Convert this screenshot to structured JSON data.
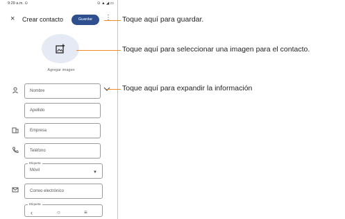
{
  "status_bar": {
    "time": "9:29 a.m. ⊙",
    "icons": "⊙ ▲ ◢ ▭"
  },
  "app_bar": {
    "close_icon": "×",
    "title": "Crear contacto",
    "save_label": "Guardar",
    "more_icon": "⋮"
  },
  "photo": {
    "label": "Agregar imagen"
  },
  "fields": {
    "name": "Nombre",
    "last_name": "Apellido",
    "company": "Empresa",
    "phone": "Teléfono",
    "phone_tag": "Etiqueta",
    "phone_type": "Móvil",
    "email": "Correo electrónico",
    "email_tag": "Etiqueta"
  },
  "nav": {
    "back": "‹",
    "home": "○",
    "recents": "≡"
  },
  "callouts": {
    "save": "Toque aquí para guardar.",
    "image": "Toque aquí para seleccionar una imagen para el contacto.",
    "expand": "Toque aquí para expandir la información"
  },
  "colors": {
    "accent": "#2f4f8f",
    "leader": "#f08a24",
    "photo_bg": "#e5eaf5"
  }
}
